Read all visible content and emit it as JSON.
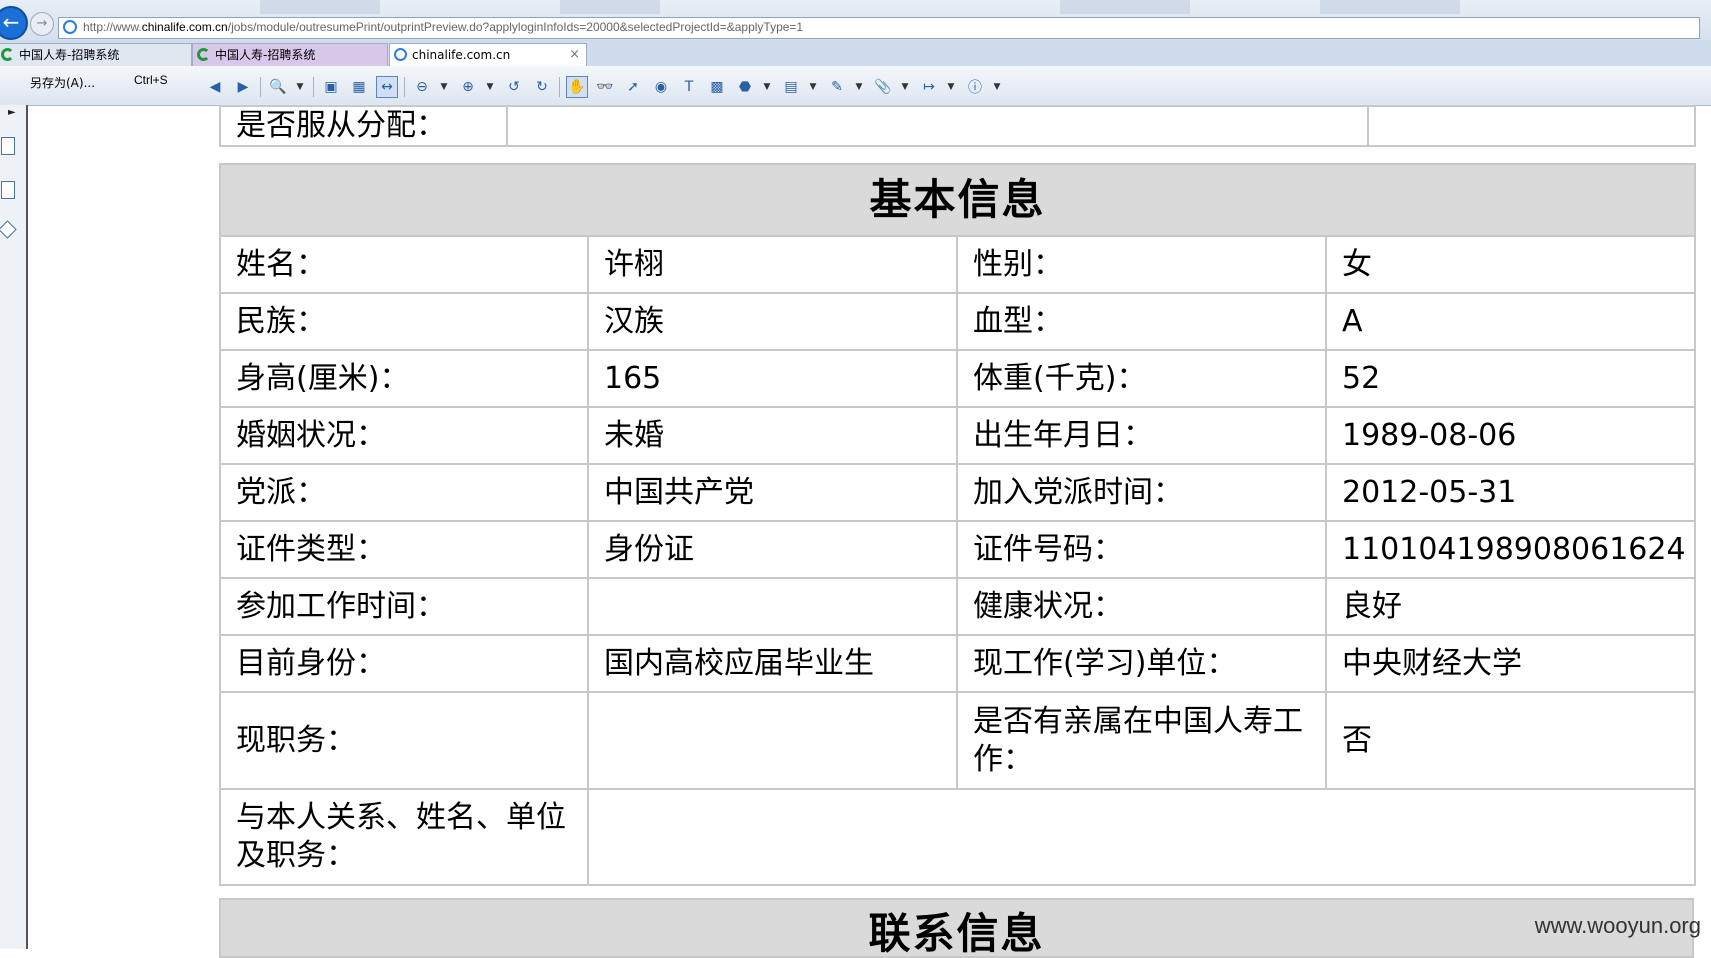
{
  "browser": {
    "url_prefix": "http://www.",
    "url_domain": "chinalife.com.cn",
    "url_path": "/jobs/module/outresumePrint/outprintPreview.do?applyloginInfoIds=20000&selectedProjectId=&applyType=1",
    "tabs": [
      {
        "label": "中国人寿-招聘系统"
      },
      {
        "label": "中国人寿-招聘系统"
      },
      {
        "label": "chinalife.com.cn"
      }
    ],
    "close_glyph": "×",
    "save_as_label": "另存为(A)...",
    "shortcut_label": "Ctrl+S"
  },
  "prev_row": {
    "label": "是否服从分配："
  },
  "basic_info": {
    "title": "基本信息",
    "rows": [
      {
        "l1": "姓名：",
        "v1": "许栩",
        "l2": "性别：",
        "v2": "女"
      },
      {
        "l1": "民族：",
        "v1": "汉族",
        "l2": "血型：",
        "v2": "A"
      },
      {
        "l1": "身高(厘米)：",
        "v1": "165",
        "l2": "体重(千克)：",
        "v2": "52"
      },
      {
        "l1": "婚姻状况：",
        "v1": "未婚",
        "l2": "出生年月日：",
        "v2": "1989-08-06"
      },
      {
        "l1": "党派：",
        "v1": "中国共产党",
        "l2": "加入党派时间：",
        "v2": "2012-05-31"
      },
      {
        "l1": "证件类型：",
        "v1": "身份证",
        "l2": "证件号码：",
        "v2": "110104198908061624"
      },
      {
        "l1": "参加工作时间：",
        "v1": "",
        "l2": "健康状况：",
        "v2": "良好"
      },
      {
        "l1": "目前身份：",
        "v1": "国内高校应届毕业生",
        "l2": "现工作(学习)单位：",
        "v2": "中央财经大学"
      },
      {
        "l1": "现职务：",
        "v1": "",
        "l2": "是否有亲属在中国人寿工作：",
        "v2": "否"
      }
    ],
    "relation_label": "与本人关系、姓名、单位及职务：",
    "relation_value": ""
  },
  "contact_info": {
    "title": "联系信息"
  },
  "watermark": "www.wooyun.org"
}
